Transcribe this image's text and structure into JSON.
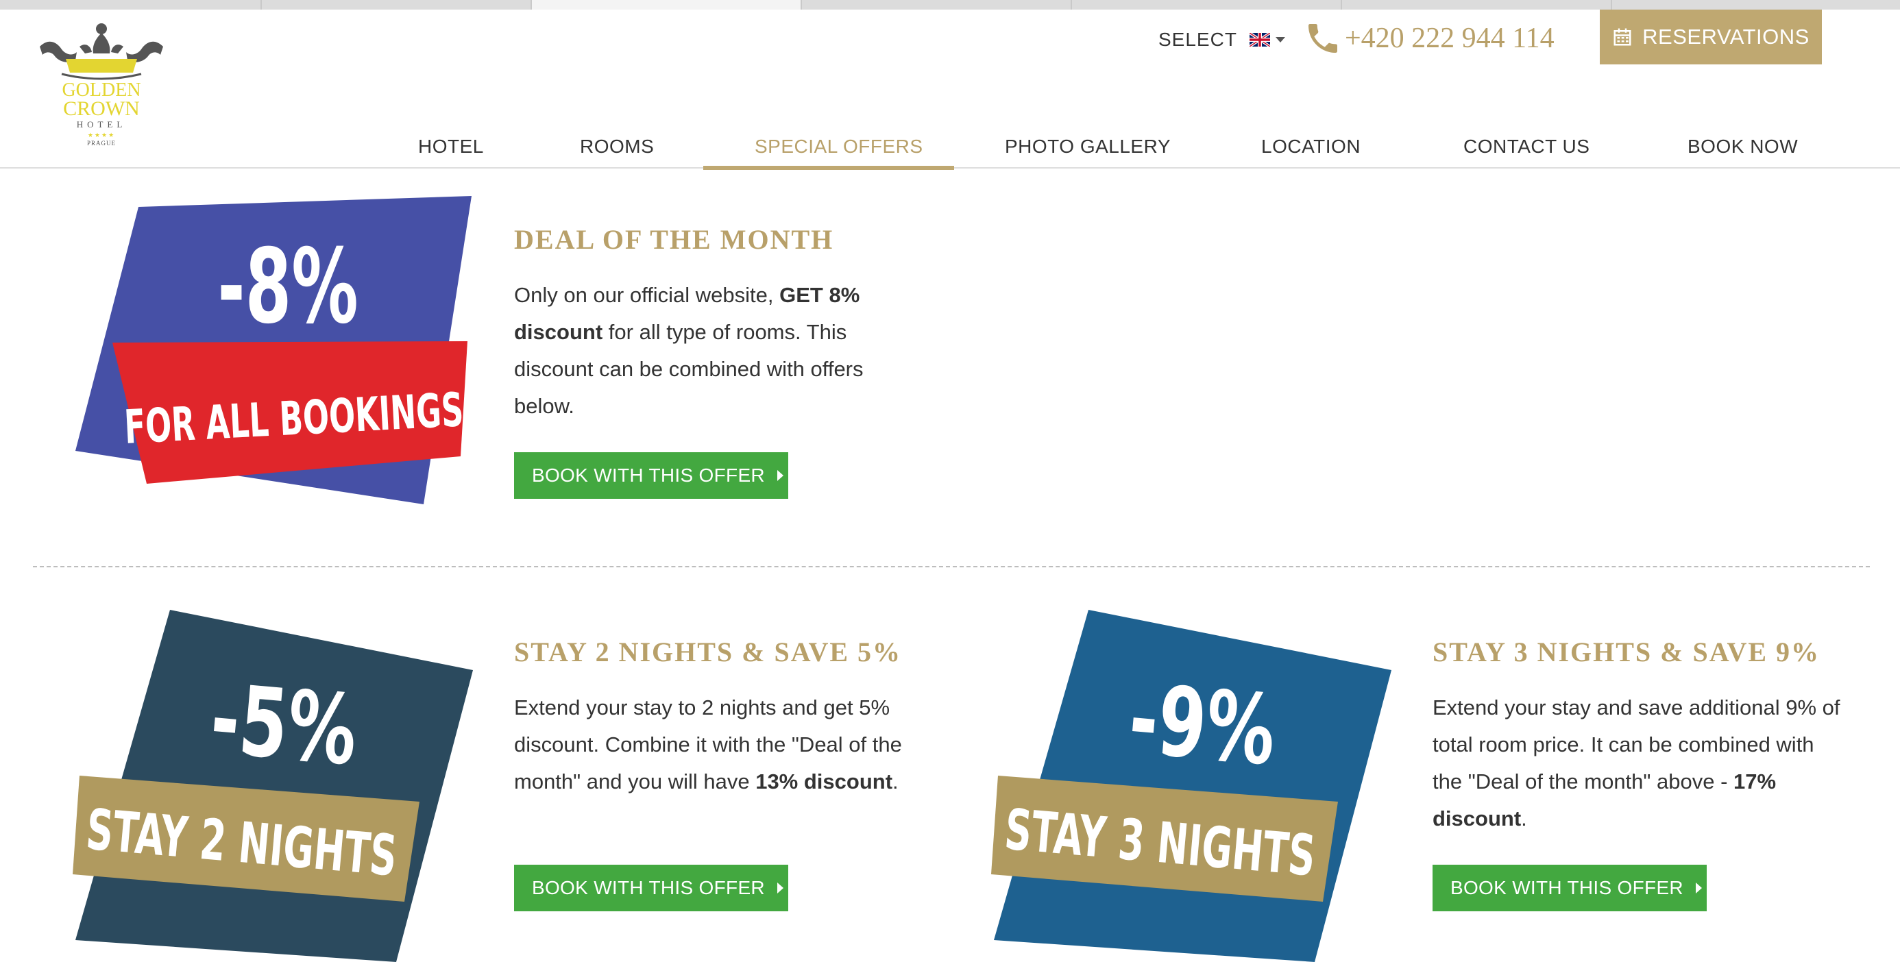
{
  "brand": {
    "line1": "GOLDEN",
    "line2": "CROWN",
    "line3": "HOTEL",
    "stars": "★★★★",
    "city": "PRAGUE"
  },
  "header": {
    "language_label": "SELECT",
    "phone": "+420 222 944 114",
    "reservations_label": "RESERVATIONS"
  },
  "nav": [
    {
      "label": "HOTEL"
    },
    {
      "label": "ROOMS"
    },
    {
      "label": "SPECIAL OFFERS",
      "active": true
    },
    {
      "label": "PHOTO GALLERY"
    },
    {
      "label": "LOCATION"
    },
    {
      "label": "CONTACT US"
    },
    {
      "label": "BOOK NOW"
    }
  ],
  "offers": [
    {
      "badge_percent": "-8%",
      "badge_caption": "FOR ALL BOOKINGS",
      "title": "DEAL OF THE MONTH",
      "text_parts": [
        "Only on our official website, ",
        "GET 8% discount",
        " for all type of rooms. This discount can be combined with offers below."
      ],
      "button": "BOOK WITH THIS OFFER"
    },
    {
      "badge_percent": "-5%",
      "badge_caption": "STAY 2 NIGHTS",
      "title": "STAY 2 NIGHTS & SAVE 5%",
      "text_parts": [
        "Extend your stay to 2 nights and get 5% discount. Combine it with the \"Deal of the month\"  and you will have ",
        "13% discount",
        "."
      ],
      "button": "BOOK WITH THIS OFFER"
    },
    {
      "badge_percent": "-9%",
      "badge_caption": "STAY 3 NIGHTS",
      "title": "STAY 3 NIGHTS & SAVE 9%",
      "text_parts": [
        "Extend your stay and save additional 9% of total room price. It can be combined with the \"Deal of the month\" above - ",
        "17% discount",
        "."
      ],
      "button": "BOOK WITH THIS OFFER"
    }
  ],
  "colors": {
    "gold": "#b8a069",
    "button_green": "#43a840",
    "badge1_back": "#4650a6",
    "badge1_ribbon": "#e0262b",
    "badge2_back": "#2b4a5e",
    "badge3_back": "#1e6190",
    "ribbon_gold": "#b09a5f"
  }
}
